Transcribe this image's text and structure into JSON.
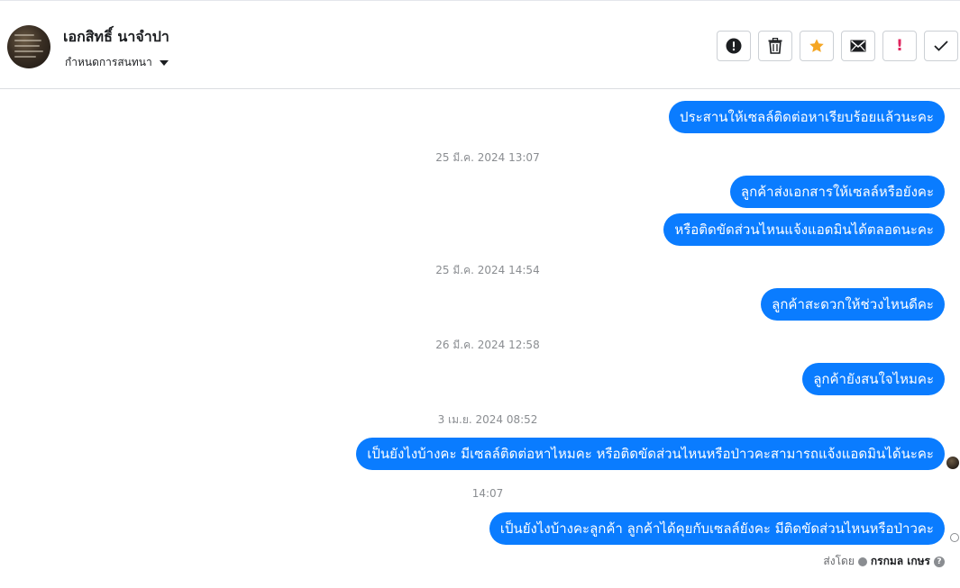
{
  "header": {
    "contact_name": "เอกสิทธิ์ นาจำปา",
    "assign_label": "กำหนดการสนทนา"
  },
  "toolbar": {
    "buttons": [
      {
        "name": "mark-spam-button",
        "icon": "alert-circle-icon"
      },
      {
        "name": "delete-button",
        "icon": "trash-icon"
      },
      {
        "name": "star-button",
        "icon": "star-icon",
        "color": "#f5a623"
      },
      {
        "name": "mark-unread-button",
        "icon": "envelope-icon"
      },
      {
        "name": "follow-up-button",
        "icon": "exclamation-icon",
        "text": "!",
        "color": "#e0245e"
      },
      {
        "name": "mark-done-button",
        "icon": "checkmark-icon"
      }
    ]
  },
  "thread": {
    "bubble_color": "#0a7cff",
    "items": [
      {
        "type": "message",
        "text": "ประสานให้เซลล์ติดต่อหาเรียบร้อยแล้วนะคะ"
      },
      {
        "type": "timestamp",
        "text": "25 มี.ค. 2024 13:07"
      },
      {
        "type": "message",
        "text": "ลูกค้าส่งเอกสารให้เซลล์หรือยังคะ"
      },
      {
        "type": "message",
        "text": "หรือติดขัดส่วนไหนแจ้งแอดมินได้ตลอดนะคะ"
      },
      {
        "type": "timestamp",
        "text": "25 มี.ค. 2024 14:54"
      },
      {
        "type": "message",
        "text": "ลูกค้าสะดวกให้ช่วงไหนดีคะ"
      },
      {
        "type": "timestamp",
        "text": "26 มี.ค. 2024 12:58"
      },
      {
        "type": "message",
        "text": "ลูกค้ายังสนใจไหมคะ"
      },
      {
        "type": "timestamp",
        "text": "3 เม.ย. 2024 08:52"
      },
      {
        "type": "message",
        "text": "เป็นยังไงบ้างคะ มีเซลล์ติดต่อหาไหมคะ หรือติดขัดส่วนไหนหรือป่าวคะสามารถแจ้งแอดมินได้นะคะ"
      },
      {
        "type": "timestamp",
        "text": "14:07"
      },
      {
        "type": "message",
        "text": "เป็นยังไงบ้างคะลูกค้า ลูกค้าได้คุยกับเซลล์ยังคะ มีติดขัดส่วนไหนหรือป่าวคะ"
      }
    ],
    "sent_by_label": "ส่งโดย",
    "sent_by_name": "กรกมล เกษร"
  }
}
